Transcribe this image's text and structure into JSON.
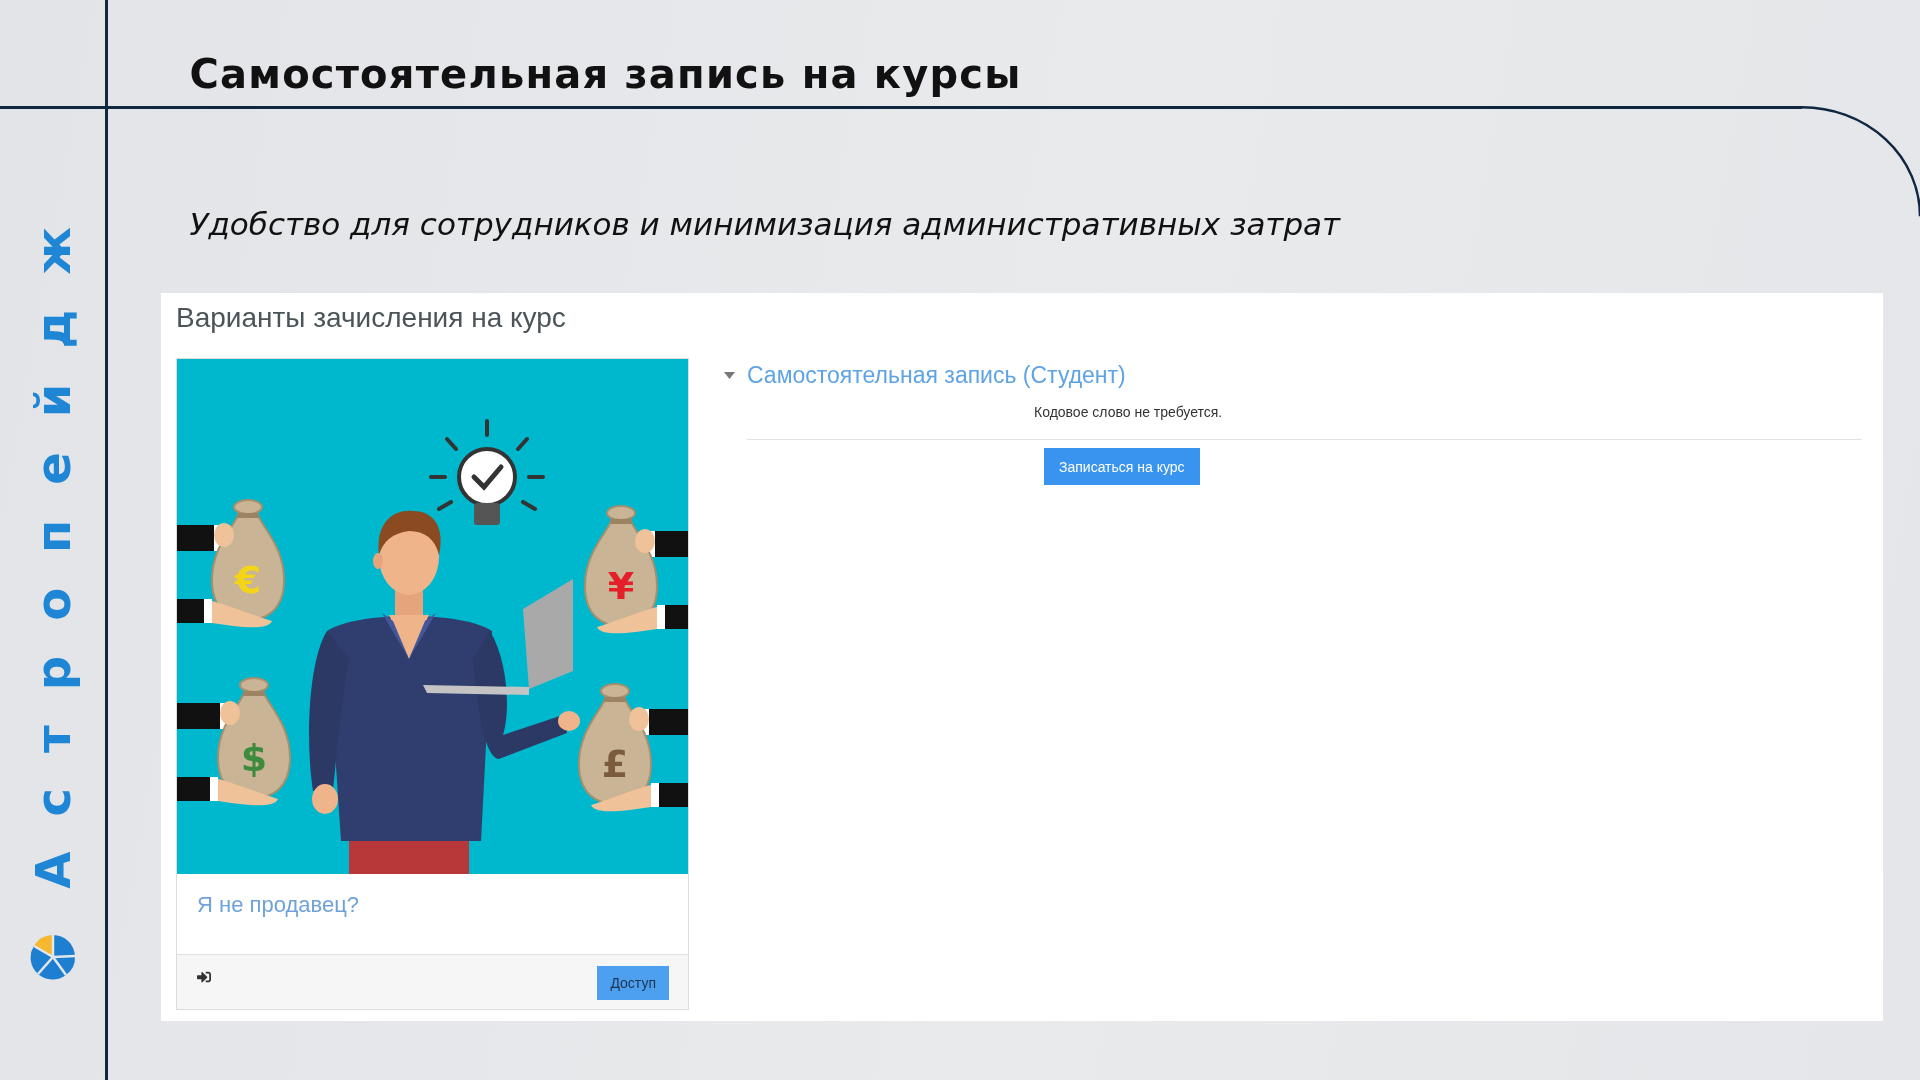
{
  "brand": {
    "name": "Астропейдж"
  },
  "slide": {
    "title": "Самостоятельная запись на курсы",
    "subtitle": "Удобство для сотрудников и минимизация административных затрат"
  },
  "panel": {
    "title": "Варианты зачисления на курс",
    "course_card": {
      "illustration": {
        "bags": [
          {
            "symbol": "€",
            "color": "#f3d416"
          },
          {
            "symbol": "¥",
            "color": "#e3202a"
          },
          {
            "symbol": "$",
            "color": "#3d8b3d"
          },
          {
            "symbol": "£",
            "color": "#7b5b3c"
          }
        ]
      },
      "name": "Я не продавец?",
      "access_button": "Доступ"
    },
    "enrolment": {
      "heading": "Самостоятельная запись (Студент)",
      "expanded": true,
      "note": "Кодовое слово не требуется.",
      "button": "Записаться на курс"
    }
  }
}
